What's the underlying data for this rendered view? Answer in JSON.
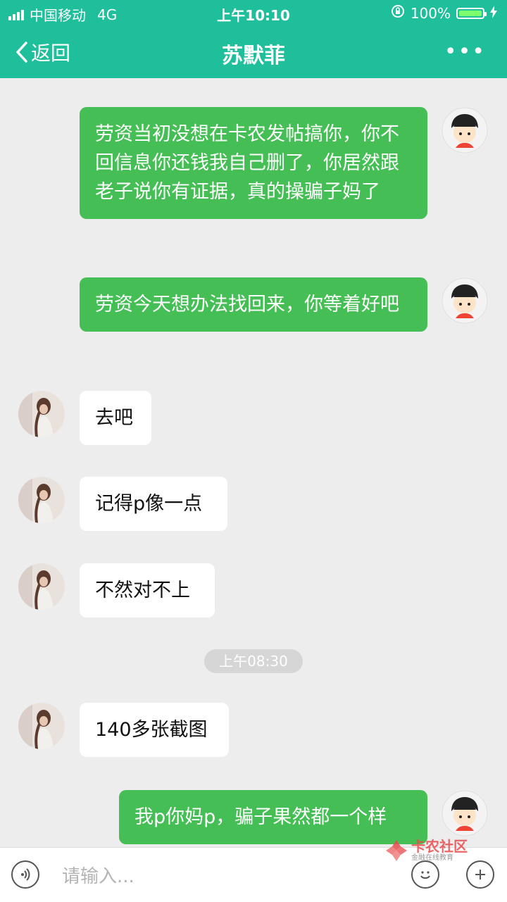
{
  "status": {
    "carrier": "中国移动",
    "network": "4G",
    "time": "上午10:10",
    "battery": "100%"
  },
  "nav": {
    "back_label": "返回",
    "title": "苏默菲",
    "more": "•••"
  },
  "messages": [
    {
      "side": "me",
      "text": "劳资当初没想在卡农发帖搞你，你不回信息你还钱我自己删了，你居然跟老子说你有证据，真的操骗子妈了"
    },
    {
      "side": "me",
      "text": "劳资今天想办法找回来，你等着好吧"
    },
    {
      "side": "them",
      "text": "去吧"
    },
    {
      "side": "them",
      "text": "记得p像一点"
    },
    {
      "side": "them",
      "text": "不然对不上"
    },
    {
      "side": "them",
      "text": "140多张截图"
    },
    {
      "side": "me",
      "text": "我p你妈p，骗子果然都一个样"
    }
  ],
  "timestamp": "上午08:30",
  "input": {
    "placeholder": "请输入..."
  },
  "watermark": {
    "main": "卡农社区",
    "sub": "金融在线教育"
  },
  "colors": {
    "header": "#1fbf9c",
    "my_bubble": "#45bf55",
    "their_bubble": "#ffffff"
  }
}
